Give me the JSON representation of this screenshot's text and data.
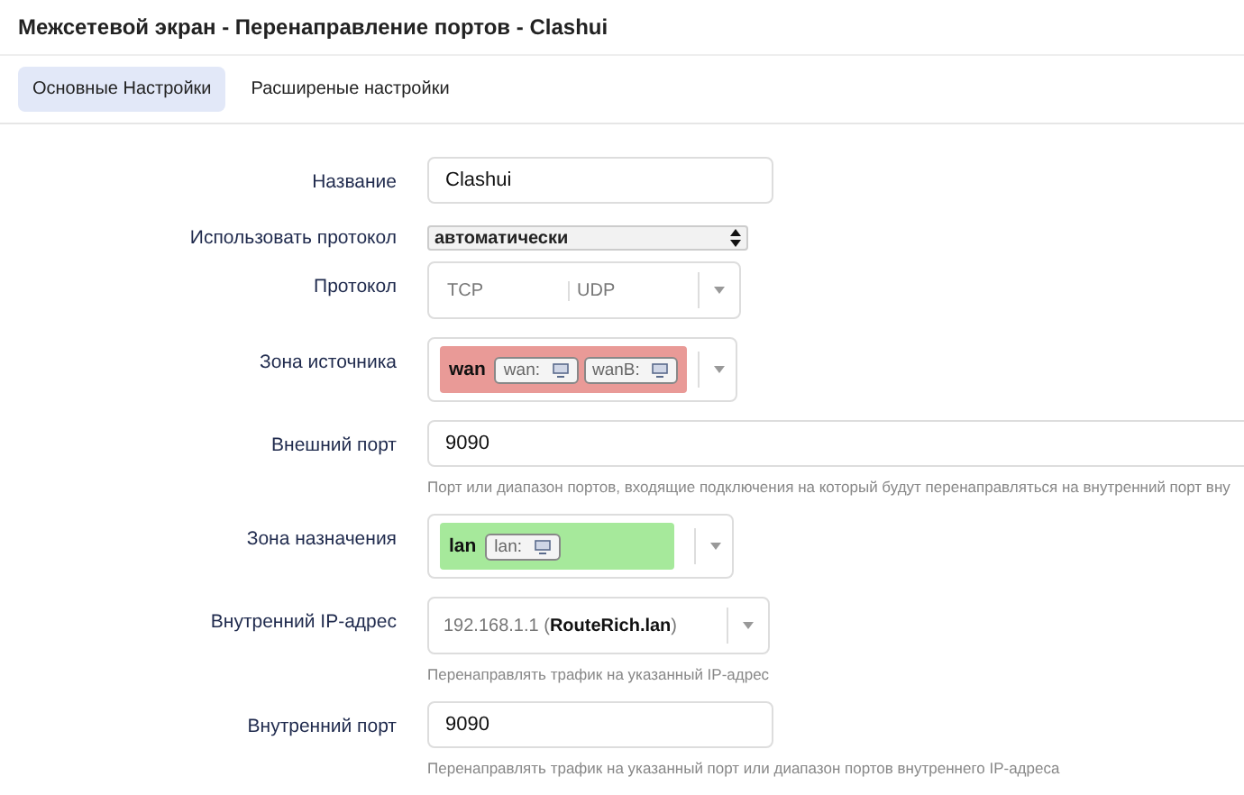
{
  "title": "Межсетевой экран - Перенаправление портов - Clashui",
  "tabs": [
    {
      "label": "Основные Настройки",
      "selected": true
    },
    {
      "label": "Расширеные настройки",
      "selected": false
    }
  ],
  "rows": [
    {
      "kind": "text",
      "label": "Название",
      "value": "Clashui"
    },
    {
      "kind": "select",
      "label": "Использовать протокол",
      "value": "автоматически"
    },
    {
      "kind": "multi",
      "label": "Протокол",
      "options": [
        "TCP",
        "UDP"
      ]
    },
    {
      "kind": "zone",
      "label": "Зона источника",
      "zone": "wan",
      "color": "#e99a97",
      "networks": [
        "wan:",
        "wanB:"
      ]
    },
    {
      "kind": "text",
      "label": "Внешний порт",
      "value": "9090",
      "wide": true,
      "hint": "Порт или диапазон портов, входящие подключения на который будут перенаправляться на внутренний порт вну"
    },
    {
      "kind": "zone",
      "label": "Зона назначения",
      "zone": "lan",
      "color": "#a6e99b",
      "networks": [
        "lan:"
      ]
    },
    {
      "kind": "ip",
      "label": "Внутренний IP-адрес",
      "value": "192.168.1.1 (**RouteRich.lan**)",
      "hint": "Перенаправлять трафик на указанный IP-адрес"
    },
    {
      "kind": "text",
      "label": "Внутренний порт",
      "value": "9090",
      "hint": "Перенаправлять трафик на указанный порт или диапазон портов внутреннего IP-адреса"
    }
  ]
}
